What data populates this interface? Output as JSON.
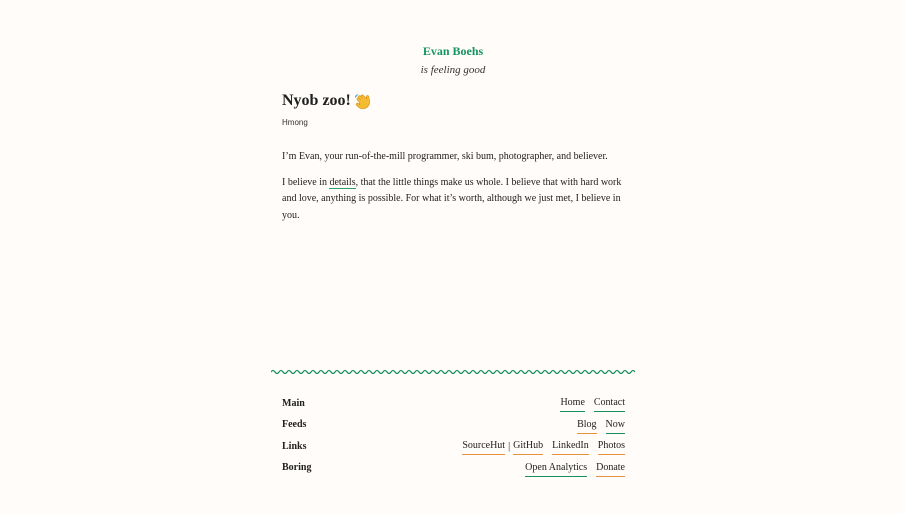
{
  "header": {
    "site_title": "Evan Boehs",
    "mood": "is feeling good"
  },
  "main": {
    "greeting": "Nyob zoo!",
    "greeting_icon": "waving-hand-icon",
    "language": "Hmong",
    "paragraph_one": "I’m Evan, your run-of-the-mill programmer, ski bum, photographer, and believer.",
    "paragraph_two": {
      "before_link": "I believe in ",
      "details_link": "details",
      "after_link": ", that the little things make us whole. I believe that with hard work and love, anything is possible. For what it’s worth, although we just met, I believe in you."
    }
  },
  "footer": {
    "divider_color": "#148f5d",
    "rows": [
      {
        "heading": "Main",
        "links": [
          "Home",
          "Contact"
        ]
      },
      {
        "heading": "Feeds",
        "links": [
          "Blog",
          "Now"
        ]
      },
      {
        "heading": "Links",
        "links": [
          "SourceHut",
          "GitHub",
          "LinkedIn",
          "Photos"
        ],
        "separator": "|"
      },
      {
        "heading": "Boring",
        "links": [
          "Open Analytics",
          "Donate"
        ]
      }
    ]
  },
  "colors": {
    "background": "#fffcf9",
    "site_title": "#14955e",
    "green_underline": "#148f5d",
    "orange_underline": "#e5903a"
  }
}
